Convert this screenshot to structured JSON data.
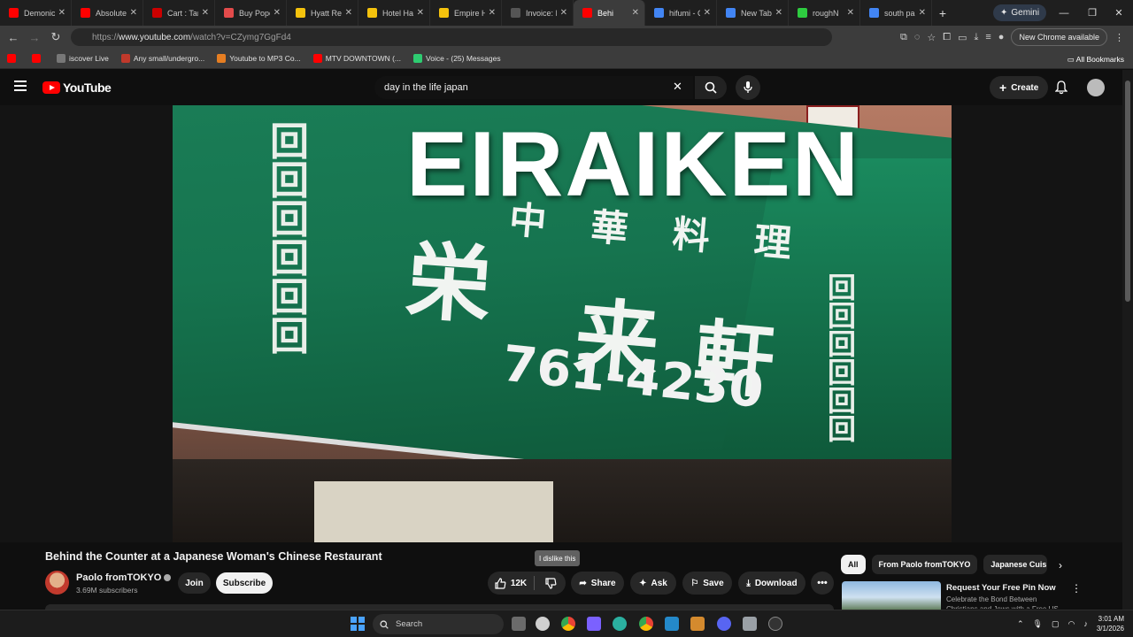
{
  "browser": {
    "tabs": [
      {
        "label": "Demonic",
        "color": "#ff0000"
      },
      {
        "label": "Absolute",
        "color": "#ff0000"
      },
      {
        "label": "Cart : Tar",
        "color": "#cc0000"
      },
      {
        "label": "Buy Popc",
        "color": "#e34b4b"
      },
      {
        "label": "Hyatt Re",
        "color": "#f4c20d"
      },
      {
        "label": "Hotel Ha",
        "color": "#f4c20d"
      },
      {
        "label": "Empire H",
        "color": "#f4c20d"
      },
      {
        "label": "Invoice: I",
        "color": "#555555"
      },
      {
        "label": "Behi",
        "color": "#ff0000"
      },
      {
        "label": "hifumi - C",
        "color": "#4285f4"
      },
      {
        "label": "New Tab",
        "color": "#4285f4"
      },
      {
        "label": "roughN",
        "color": "#2ecc40"
      },
      {
        "label": "south pa",
        "color": "#4285f4"
      }
    ],
    "new_tab": "+",
    "gemini_label": "Gemini",
    "window_controls": [
      "—",
      "❐",
      "✕"
    ],
    "url_prefix": "https://",
    "url_host": "www.youtube.com",
    "url_path": "/watch?v=CZymg7GgFd4",
    "chrome_available": "New Chrome available",
    "bookmarks": [
      {
        "label": "",
        "color": "#ff0000"
      },
      {
        "label": "",
        "color": "#ff0000"
      },
      {
        "label": "iscover Live",
        "color": "#777777"
      },
      {
        "label": "Any small/undergro...",
        "color": "#c0392b"
      },
      {
        "label": "Youtube to MP3 Co...",
        "color": "#e67e22"
      },
      {
        "label": "MTV DOWNTOWN (...",
        "color": "#ff0000"
      },
      {
        "label": "Voice - (25) Messages",
        "color": "#2ecc71"
      }
    ],
    "all_bookmarks": "All Bookmarks"
  },
  "youtube": {
    "logo_text": "YouTube",
    "search_query": "day in the life japan",
    "create_label": "Create",
    "accent": "#ff0000"
  },
  "video": {
    "overlay_title": "EIRAIKEN",
    "sign_kanji_small": "中 華 料 理",
    "sign_kanji_large": [
      "栄",
      "来",
      "軒"
    ],
    "phone": "761-4230",
    "title": "Behind the Counter at a Japanese Woman's Chinese Restaurant",
    "channel": "Paolo fromTOKYO",
    "subscribers": "3.69M subscribers",
    "join": "Join",
    "subscribe": "Subscribe",
    "likes": "12K",
    "dislike_tooltip": "I dislike this",
    "share": "Share",
    "ask": "Ask",
    "save": "Save",
    "download": "Download"
  },
  "sidebar": {
    "chips": [
      "All",
      "From Paolo fromTOKYO",
      "Japanese Cuisine"
    ],
    "ad_title": "Request Your Free Pin Now",
    "ad_desc": "Celebrate the Bond Between Christians and Jews with a Free US"
  },
  "taskbar": {
    "search_label": "Search",
    "time": "3:01 AM",
    "date": "3/1/2026"
  }
}
